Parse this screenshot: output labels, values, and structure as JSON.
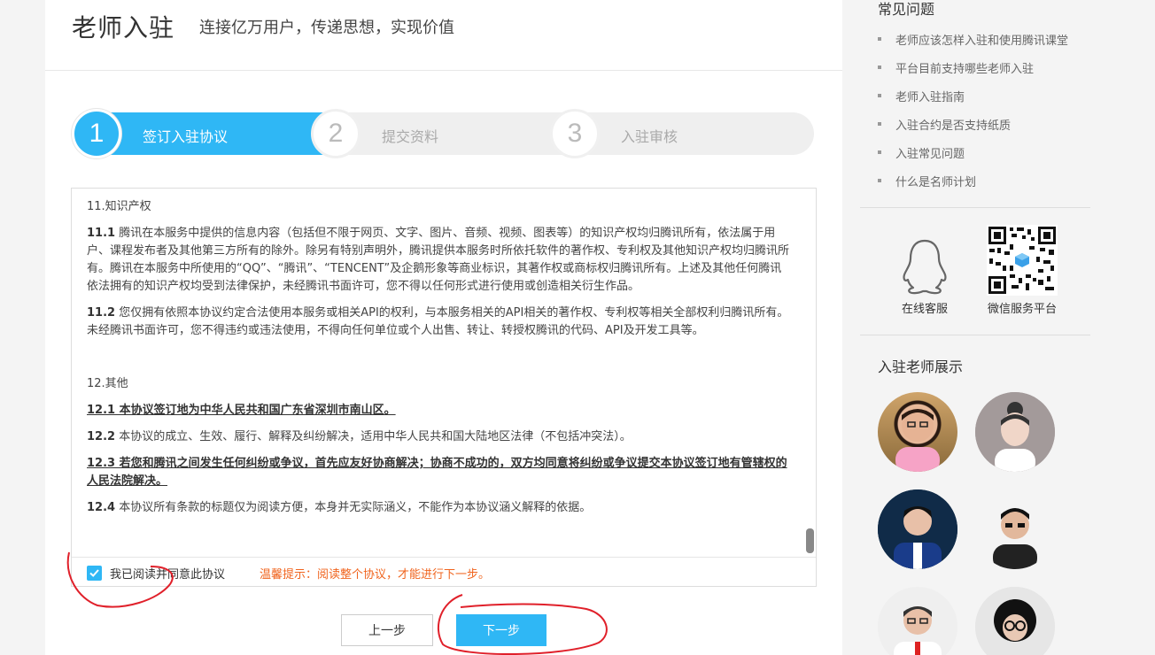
{
  "header": {
    "title": "老师入驻",
    "subtitle": "连接亿万用户，传递思想，实现价值"
  },
  "steps": [
    {
      "number": "1",
      "label": "签订入驻协议",
      "active": true
    },
    {
      "number": "2",
      "label": "提交资料",
      "active": false
    },
    {
      "number": "3",
      "label": "入驻审核",
      "active": false
    }
  ],
  "agreement": {
    "section11_title": "11.知识产权",
    "p11_1_num": "11.1",
    "p11_1_text": "腾讯在本服务中提供的信息内容（包括但不限于网页、文字、图片、音频、视频、图表等）的知识产权均归腾讯所有，依法属于用户、课程发布者及其他第三方所有的除外。除另有特别声明外，腾讯提供本服务时所依托软件的著作权、专利权及其他知识产权均归腾讯所有。腾讯在本服务中所使用的“QQ”、“腾讯”、“TENCENT”及企鹅形象等商业标识，其著作权或商标权归腾讯所有。上述及其他任何腾讯依法拥有的知识产权均受到法律保护，未经腾讯书面许可，您不得以任何形式进行使用或创造相关衍生作品。",
    "p11_2_num": "11.2",
    "p11_2_text": "您仅拥有依照本协议约定合法使用本服务或相关API的权利，与本服务相关的API相关的著作权、专利权等相关全部权利归腾讯所有。未经腾讯书面许可，您不得违约或违法使用，不得向任何单位或个人出售、转让、转授权腾讯的代码、API及开发工具等。",
    "section12_title": "12.其他",
    "p12_1": "12.1 本协议签订地为中华人民共和国广东省深圳市南山区。",
    "p12_2_num": "12.2",
    "p12_2_text": "本协议的成立、生效、履行、解释及纠纷解决，适用中华人民共和国大陆地区法律（不包括冲突法）。",
    "p12_3": "12.3 若您和腾讯之间发生任何纠纷或争议，首先应友好协商解决；协商不成功的，双方均同意将纠纷或争议提交本协议签订地有管辖权的人民法院解决。",
    "p12_4_num": "12.4",
    "p12_4_text": "本协议所有条款的标题仅为阅读方便，本身并无实际涵义，不能作为本协议涵义解释的依据。"
  },
  "agree": {
    "label": "我已阅读并同意此协议",
    "tip": "温馨提示：阅读整个协议，才能进行下一步。",
    "checked": true
  },
  "buttons": {
    "prev": "上一步",
    "next": "下一步"
  },
  "sidebar": {
    "faq_title": "常见问题",
    "faq_items": [
      "老师应该怎样入驻和使用腾讯课堂",
      "平台目前支持哪些老师入驻",
      "老师入驻指南",
      "入驻合约是否支持纸质",
      "入驻常见问题",
      "什么是名师计划"
    ],
    "online_service": "在线客服",
    "wechat_service": "微信服务平台",
    "teachers_title": "入驻老师展示"
  },
  "colors": {
    "accent": "#2fb7f5",
    "tip": "#f0641e",
    "annotation": "#e0202a"
  },
  "icons": [
    "qq-penguin-icon",
    "qr-code-icon",
    "check-icon"
  ]
}
